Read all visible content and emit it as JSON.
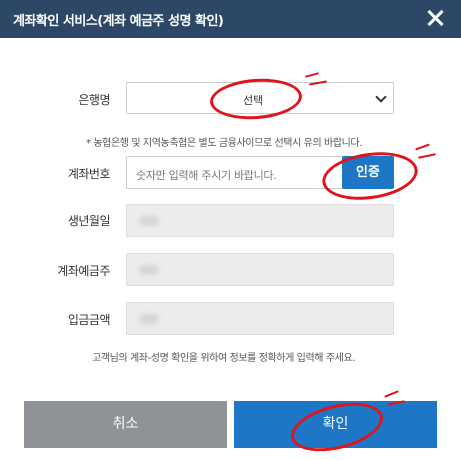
{
  "header": {
    "title": "계좌확인 서비스(계좌 예금주 성명 확인)",
    "close_icon": "close-icon"
  },
  "form": {
    "bank": {
      "label": "은행명",
      "selected": "선택"
    },
    "notice": "* 농협은행 및 지역농축협은 별도 금융사이므로 선택시 유의 바랍니다.",
    "account": {
      "label": "계좌번호",
      "placeholder": "숫자만 입력해 주시기 바랍니다.",
      "button": "인증"
    },
    "birth": {
      "label": "생년월일",
      "value": ""
    },
    "holder": {
      "label": "계좌예금주",
      "value": ""
    },
    "amount": {
      "label": "입금금액",
      "value": ""
    }
  },
  "footnote": "고객님의 계좌-성명 확인을 위하여 정보를 정확하게 입력해 주세요.",
  "buttons": {
    "cancel": "취소",
    "confirm": "확인"
  },
  "colors": {
    "header_bg": "#2d4867",
    "primary": "#1d77c6",
    "cancel": "#8f9296",
    "annotation": "#e0141b"
  }
}
